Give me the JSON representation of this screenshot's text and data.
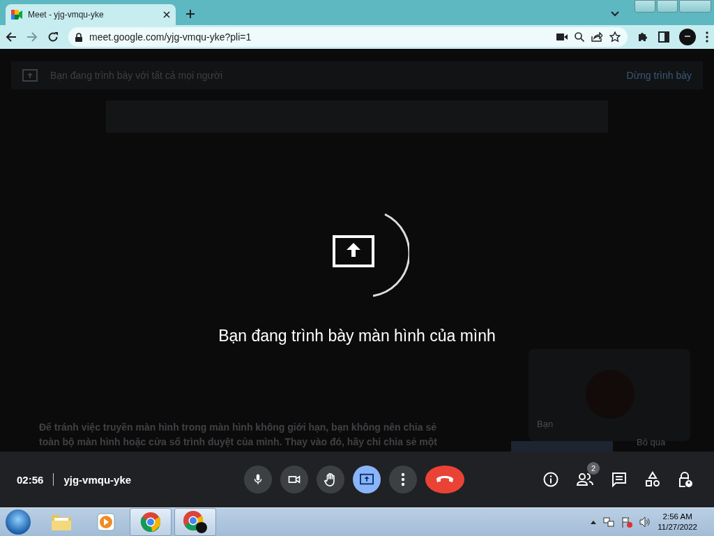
{
  "browser": {
    "tabs": [
      {
        "title": "Meet - yjg-vmqu-yke",
        "selected": true
      }
    ],
    "address": "meet.google.com/yjg-vmqu-yke?pli=1"
  },
  "presenting_banner": {
    "text": "Bạn đang trình bày với tất cả mọi người",
    "action": "Dừng trình bày"
  },
  "center": {
    "message": "Bạn đang trình bày màn hình của mình"
  },
  "warning": {
    "lines": [
      "Để tránh việc truyền màn hình trong màn hình không giới hạn, bạn không nên chia sẻ",
      "toàn bộ màn hình hoặc cửa sổ trình duyệt của mình. Thay vào đó, hãy chỉ chia sẻ một"
    ]
  },
  "self_tile": {
    "name": "Bạn"
  },
  "dialog": {
    "dismiss": "Bỏ qua"
  },
  "call_bar": {
    "time": "02:56",
    "meeting_code": "yjg-vmqu-yke",
    "controls": [
      {
        "kind": "mic",
        "selected": false
      },
      {
        "kind": "camera",
        "selected": false
      },
      {
        "kind": "hand",
        "selected": false
      },
      {
        "kind": "present",
        "selected": true
      },
      {
        "kind": "more",
        "selected": false
      },
      {
        "kind": "hangup",
        "selected": false
      }
    ],
    "panels": [
      {
        "kind": "info"
      },
      {
        "kind": "people",
        "badge": "2"
      },
      {
        "kind": "chat"
      },
      {
        "kind": "activities"
      },
      {
        "kind": "host"
      }
    ]
  },
  "taskbar": {
    "apps": [
      {
        "kind": "folder",
        "selected": false
      },
      {
        "kind": "media",
        "selected": false
      },
      {
        "kind": "chrome",
        "selected": true
      },
      {
        "kind": "chrome-profile",
        "selected": true
      }
    ],
    "time": "2:56 AM",
    "date": "11/27/2022"
  }
}
